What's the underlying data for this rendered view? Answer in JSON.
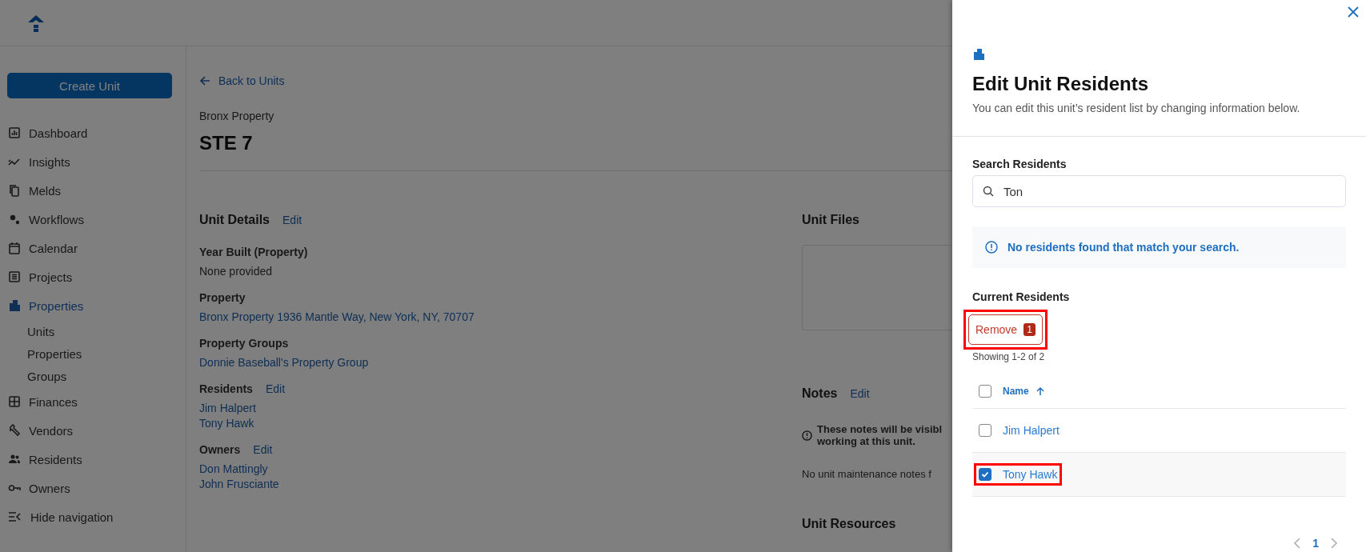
{
  "sidebar": {
    "create_button": "Create Unit",
    "nav": [
      {
        "label": "Dashboard",
        "selected": false
      },
      {
        "label": "Insights",
        "selected": false
      },
      {
        "label": "Melds",
        "selected": false
      },
      {
        "label": "Workflows",
        "selected": false
      },
      {
        "label": "Calendar",
        "selected": false
      },
      {
        "label": "Projects",
        "selected": false
      },
      {
        "label": "Properties",
        "selected": true,
        "children": [
          {
            "label": "Units",
            "selected": false
          },
          {
            "label": "Properties",
            "selected": false
          },
          {
            "label": "Groups",
            "selected": false
          }
        ]
      },
      {
        "label": "Finances",
        "selected": false
      },
      {
        "label": "Vendors",
        "selected": false
      },
      {
        "label": "Residents",
        "selected": false
      },
      {
        "label": "Owners",
        "selected": false
      }
    ],
    "hide_navigation": "Hide navigation"
  },
  "main": {
    "back_link": "Back to Units",
    "property": "Bronx Property",
    "unit": "STE 7",
    "details": {
      "title": "Unit Details",
      "edit": "Edit",
      "fields": [
        {
          "label": "Year Built (Property)",
          "kind": "text",
          "values": [
            "None provided"
          ]
        },
        {
          "label": "Property",
          "kind": "link",
          "values": [
            "Bronx Property 1936 Mantle Way, New York, NY, 70707"
          ]
        },
        {
          "label": "Property Groups",
          "kind": "link",
          "values": [
            "Donnie Baseball's Property Group"
          ]
        },
        {
          "label": "Residents",
          "edit": "Edit",
          "kind": "link",
          "values": [
            "Jim Halpert",
            "Tony Hawk"
          ]
        },
        {
          "label": "Owners",
          "edit": "Edit",
          "kind": "link",
          "values": [
            "Don Mattingly",
            "John Frusciante"
          ]
        }
      ]
    },
    "files": {
      "title": "Unit Files"
    },
    "notes": {
      "title": "Notes",
      "edit": "Edit",
      "info_lines": [
        "These notes will be visibl",
        "working at this unit."
      ],
      "empty": "No unit maintenance notes f"
    },
    "resources": {
      "title": "Unit Resources"
    }
  },
  "panel": {
    "title": "Edit Unit Residents",
    "subtitle": "You can edit this unit’s resident list by changing information below.",
    "search": {
      "label": "Search Residents",
      "value": "Ton"
    },
    "alert": "No residents found that match your search.",
    "current_title": "Current Residents",
    "remove": {
      "label": "Remove",
      "count": "1",
      "highlighted": true
    },
    "showing": "Showing 1-2 of 2",
    "table": {
      "all_checked": false,
      "columns": [
        {
          "label": "Name",
          "sort_ascending": true
        }
      ],
      "rows": [
        {
          "name": "Jim Halpert",
          "checked": false,
          "highlighted": false
        },
        {
          "name": "Tony Hawk",
          "checked": true,
          "highlighted": true
        }
      ]
    },
    "pagination": {
      "pages": [
        {
          "label": "1",
          "selected": true
        }
      ]
    }
  }
}
